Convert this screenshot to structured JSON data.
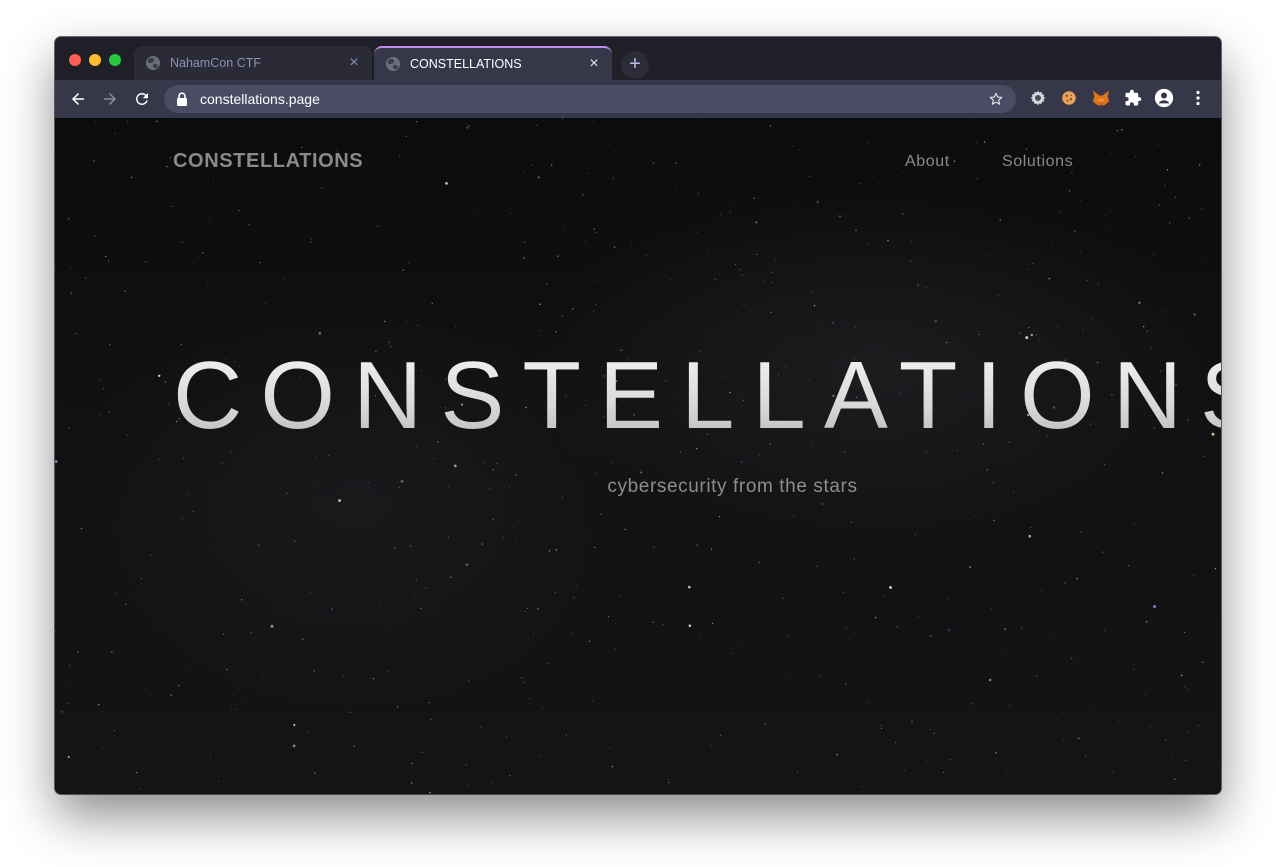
{
  "browser": {
    "tabs": [
      {
        "title": "NahamCon CTF",
        "active": false
      },
      {
        "title": "CONSTELLATIONS",
        "active": true
      }
    ],
    "new_tab_icon": "plus-icon",
    "url": "constellations.page",
    "close_glyph": "×",
    "new_tab_glyph": "+",
    "accent_color": "#c38cf5",
    "extensions": [
      "gear-extension-icon",
      "cookie-extension-icon",
      "metamask-fox-icon",
      "puzzle-extensions-icon",
      "profile-avatar-icon",
      "kebab-menu-icon"
    ]
  },
  "site": {
    "brand": "CONSTELLATIONS",
    "nav": [
      {
        "label": "About"
      },
      {
        "label": "Solutions"
      }
    ],
    "hero_title": "CONSTELLATIONS",
    "tagline": "cybersecurity from the stars"
  }
}
